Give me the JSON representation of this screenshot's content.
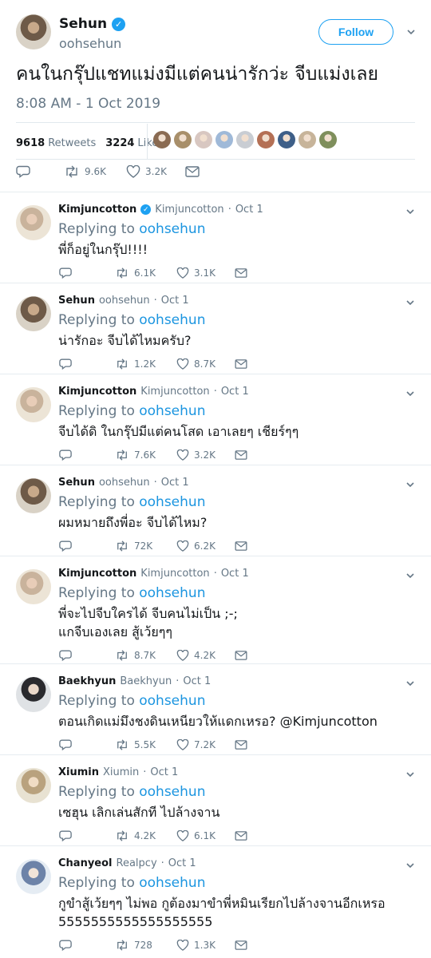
{
  "main_tweet": {
    "author_name": "Sehun",
    "handle": "oohsehun",
    "follow_label": "Follow",
    "text": "คนในกรุ๊ปแชทแม่งมีแต่คนน่ารักว่ะ จีบแม่งเลย",
    "timestamp": "8:08 AM - 1 Oct 2019",
    "retweets_count": "9618",
    "retweets_label": "Retweets",
    "likes_count": "3224",
    "likes_label": "Likes",
    "action_retweets": "9.6K",
    "action_likes": "3.2K"
  },
  "liker_colors": [
    "#8a6b52",
    "#a88f6a",
    "#d8c7c1",
    "#9fb9d8",
    "#c9cdd3",
    "#b47055",
    "#3e5f88",
    "#c7b49a",
    "#7f8f5c"
  ],
  "replies": [
    {
      "name": "Kimjuncotton",
      "handle": "Kimjuncotton",
      "date": "Oct 1",
      "verified": true,
      "replying_label": "Replying to",
      "replying_to": "oohsehun",
      "lines": [
        "พี่ก็อยู่ในกรุ๊ป!!!!"
      ],
      "retweets": "6.1K",
      "likes": "3.1K"
    },
    {
      "name": "Sehun",
      "handle": "oohsehun",
      "date": "Oct 1",
      "replying_label": "Replying to",
      "replying_to": "oohsehun",
      "lines": [
        "น่ารักอะ จีบได้ไหมครับ?"
      ],
      "retweets": "1.2K",
      "likes": "8.7K"
    },
    {
      "name": "Kimjuncotton",
      "handle": "Kimjuncotton",
      "date": "Oct 1",
      "replying_label": "Replying to",
      "replying_to": "oohsehun",
      "lines": [
        "จีบได้ดิ ในกรุ๊ปมีแต่คนโสด เอาเลยๆ เชียร์ๆๆ"
      ],
      "retweets": "7.6K",
      "likes": "3.2K"
    },
    {
      "name": "Sehun",
      "handle": "oohsehun",
      "date": "Oct 1",
      "replying_label": "Replying to",
      "replying_to": "oohsehun",
      "lines": [
        "ผมหมายถึงพี่อะ จีบได้ไหม?"
      ],
      "retweets": "72K",
      "likes": "6.2K"
    },
    {
      "name": "Kimjuncotton",
      "handle": "Kimjuncotton",
      "date": "Oct 1",
      "replying_label": "Replying to",
      "replying_to": "oohsehun",
      "lines": [
        "พี่จะไปจีบใครได้ จีบคนไม่เป็น ;-;",
        "แกจีบเองเลย สู้เว้ยๆๆ"
      ],
      "retweets": "8.7K",
      "likes": "4.2K"
    },
    {
      "name": "Baekhyun",
      "handle": "Baekhyun",
      "date": "Oct 1",
      "replying_label": "Replying to",
      "replying_to": "oohsehun",
      "lines": [
        "ตอนเกิดแม่มึงชงดินเหนียวให้แดกเหรอ? @Kimjuncotton"
      ],
      "retweets": "5.5K",
      "likes": "7.2K"
    },
    {
      "name": "Xiumin",
      "handle": "Xiumin",
      "date": "Oct 1",
      "replying_label": "Replying to",
      "replying_to": "oohsehun",
      "lines": [
        "เซฮุน เลิกเล่นสักที ไปล้างจาน"
      ],
      "retweets": "4.2K",
      "likes": "6.1K"
    },
    {
      "name": "Chanyeol",
      "handle": "Realpcy",
      "date": "Oct 1",
      "replying_label": "Replying to",
      "replying_to": "oohsehun",
      "lines": [
        "กูขำสู้เว้ยๆๆ ไม่พอ กูต้องมาขำพี่หมินเรียกไปล้างจานอีกเหรอ",
        "5555555555555555555"
      ],
      "retweets": "728",
      "likes": "1.3K"
    }
  ]
}
